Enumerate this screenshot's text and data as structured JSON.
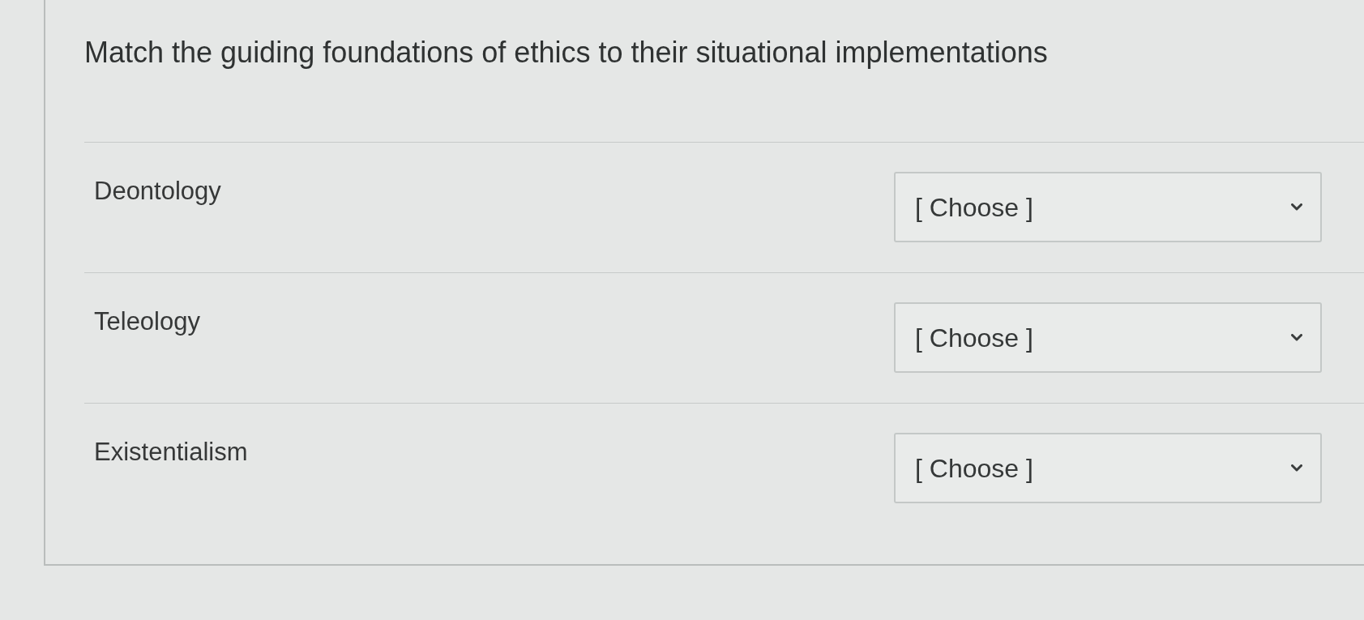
{
  "question": "Match the guiding foundations of ethics to their situational implementations",
  "pairs": [
    {
      "term": "Deontology",
      "dropdown": {
        "value": "[ Choose ]"
      }
    },
    {
      "term": "Teleology",
      "dropdown": {
        "value": "[ Choose ]"
      }
    },
    {
      "term": "Existentialism",
      "dropdown": {
        "value": "[ Choose ]"
      }
    }
  ]
}
